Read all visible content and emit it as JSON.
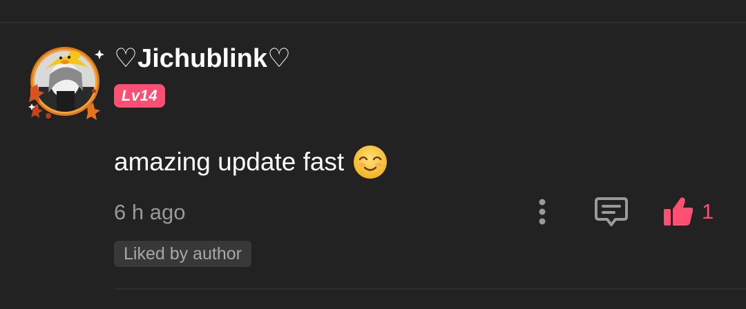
{
  "comment": {
    "username": "♡Jichublink♡",
    "level": "Lv14",
    "text": "amazing update fast",
    "emoji": "smiling-face-emoji",
    "time": "6 h ago",
    "like_count": "1",
    "liked_by_author_label": "Liked by author"
  },
  "colors": {
    "background": "#222222",
    "accent": "#ff4f73",
    "muted_text": "#9a9a9a",
    "chip_bg": "#383838"
  }
}
